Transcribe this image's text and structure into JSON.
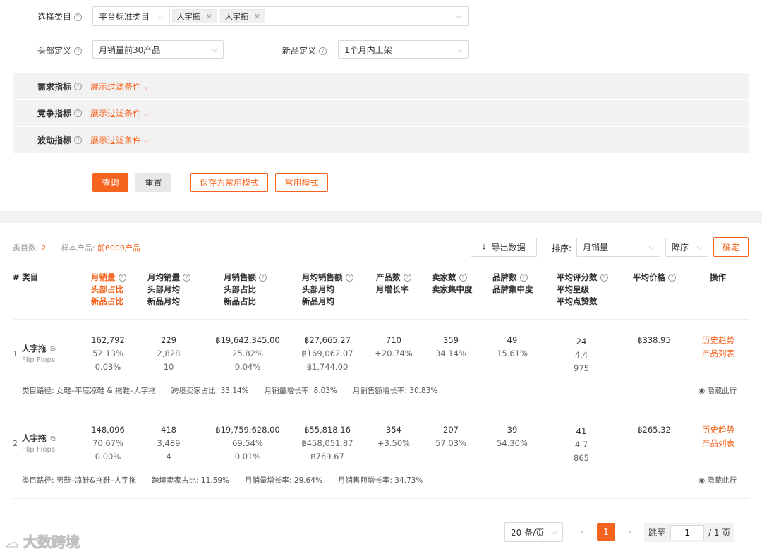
{
  "filters": {
    "category_label": "选择类目",
    "category_source": "平台标准类目",
    "category_tags": [
      "人字拖",
      "人字拖"
    ],
    "head_label": "头部定义",
    "head_value": "月销量前30产品",
    "new_label": "新品定义",
    "new_value": "1个月内上架",
    "indicator_rows": [
      {
        "label": "需求指标",
        "action": "展示过滤条件"
      },
      {
        "label": "竞争指标",
        "action": "展示过滤条件"
      },
      {
        "label": "波动指标",
        "action": "展示过滤条件"
      }
    ],
    "buttons": {
      "query": "查询",
      "reset": "重置",
      "save_mode": "保存为常用模式",
      "common_mode": "常用模式"
    }
  },
  "summary": {
    "category_count_label": "类目数:",
    "category_count": "2",
    "sample_label": "样本产品:",
    "sample_value": "前6000产品",
    "export_label": "导出数据",
    "sort_label": "排序:",
    "sort_field": "月销量",
    "sort_order": "降序",
    "confirm_label": "确定"
  },
  "table": {
    "headers": {
      "index": "#",
      "category": "类目",
      "c1": [
        "月销量",
        "头部占比",
        "新品占比"
      ],
      "c2": [
        "月均销量",
        "头部月均",
        "新品月均"
      ],
      "c3": [
        "月销售额",
        "头部占比",
        "新品占比"
      ],
      "c4": [
        "月均销售额",
        "头部月均",
        "新品月均"
      ],
      "c5": [
        "产品数",
        "月增长率"
      ],
      "c6": [
        "卖家数",
        "卖家集中度"
      ],
      "c7": [
        "品牌数",
        "品牌集中度"
      ],
      "c8": [
        "平均评分数",
        "平均星级",
        "平均点赞数"
      ],
      "c9": [
        "平均价格"
      ],
      "ops": "操作"
    },
    "rows": [
      {
        "index": "1",
        "name": "人字拖",
        "name_en": "Flip Flops",
        "c1": [
          "162,792",
          "52.13%",
          "0.03%"
        ],
        "c2": [
          "229",
          "2,828",
          "10"
        ],
        "c3": [
          "฿19,642,345.00",
          "25.82%",
          "0.04%"
        ],
        "c4": [
          "฿27,665.27",
          "฿169,062.07",
          "฿1,744.00"
        ],
        "c5": [
          "710",
          "+20.74%"
        ],
        "c6": [
          "359",
          "34.14%"
        ],
        "c7": [
          "49",
          "15.61%"
        ],
        "c8": [
          "24",
          "4.4",
          "975"
        ],
        "c9": "฿338.95",
        "op1": "历史趋势",
        "op2": "产品列表",
        "path": "类目路径: 女鞋–平底凉鞋 & 拖鞋–人字拖",
        "cross": "跨境卖家占比: 33.14%",
        "sales_growth": "月销量增长率: 8.03%",
        "revenue_growth": "月销售额增长率: 30.83%",
        "hide": "隐藏此行"
      },
      {
        "index": "2",
        "name": "人字拖",
        "name_en": "Flip Flops",
        "c1": [
          "148,096",
          "70.67%",
          "0.00%"
        ],
        "c2": [
          "418",
          "3,489",
          "4"
        ],
        "c3": [
          "฿19,759,628.00",
          "69.54%",
          "0.01%"
        ],
        "c4": [
          "฿55,818.16",
          "฿458,051.87",
          "฿769.67"
        ],
        "c5": [
          "354",
          "+3.50%"
        ],
        "c6": [
          "207",
          "57.03%"
        ],
        "c7": [
          "39",
          "54.30%"
        ],
        "c8": [
          "41",
          "4.7",
          "865"
        ],
        "c9": "฿265.32",
        "op1": "历史趋势",
        "op2": "产品列表",
        "path": "类目路径: 男鞋–凉鞋&拖鞋–人字拖",
        "cross": "跨境卖家占比: 11.59%",
        "sales_growth": "月销量增长率: 29.64%",
        "revenue_growth": "月销售额增长率: 34.73%",
        "hide": "隐藏此行"
      }
    ]
  },
  "pagination": {
    "page_size": "20 条/页",
    "current_page": "1",
    "jump_label": "跳至",
    "jump_value": "1",
    "total_pages": "/ 1 页"
  },
  "watermark": "大数跨境",
  "colors": {
    "accent": "#f5641e"
  }
}
